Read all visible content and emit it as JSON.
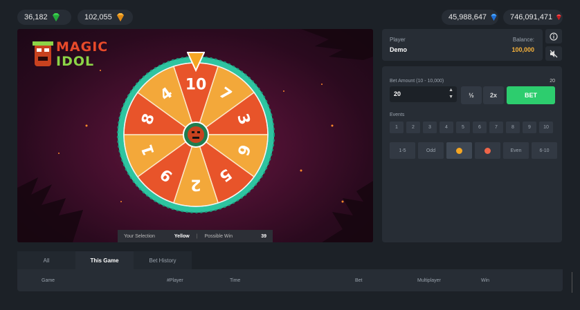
{
  "wallet": [
    {
      "value": "36,182",
      "gem": "green-gem-icon",
      "color": "#3ccf4e"
    },
    {
      "value": "102,055",
      "gem": "orange-gem-icon",
      "color": "#f7a21b"
    },
    {
      "value": "45,988,647",
      "gem": "blue-gem-icon",
      "color": "#2a8cf0"
    },
    {
      "value": "746,091,471",
      "gem": "red-gem-icon",
      "color": "#e2242b"
    }
  ],
  "game": {
    "logo_line1": "MAGIC",
    "logo_line2": "IDOL",
    "wheel_segments": [
      "10",
      "7",
      "3",
      "6",
      "5",
      "2",
      "9",
      "1",
      "8",
      "4"
    ],
    "selection_label": "Your Selection",
    "selection_value": "Yellow",
    "possible_win_label": "Possible Win",
    "possible_win_value": "39"
  },
  "player": {
    "player_label": "Player",
    "player_name": "Demo",
    "balance_label": "Balance:",
    "balance_value": "100,000"
  },
  "bet": {
    "amount_label": "Bet Amount (10 - 10,000)",
    "amount_right": "20",
    "amount_value": "20",
    "half_label": "½",
    "double_label": "2x",
    "bet_label": "BET",
    "events_label": "Events",
    "events": [
      "1",
      "2",
      "3",
      "4",
      "5",
      "6",
      "7",
      "8",
      "9",
      "10"
    ],
    "options": {
      "low": "1-5",
      "odd": "Odd",
      "even": "Even",
      "high": "6-10"
    },
    "colors": {
      "yellow": "#f5a623",
      "red": "#ef6549"
    }
  },
  "tabs": [
    "All",
    "This Game",
    "Bet History"
  ],
  "table_headers": [
    "Game",
    "#Player",
    "Time",
    "Bet",
    "Multiplayer",
    "Win"
  ]
}
